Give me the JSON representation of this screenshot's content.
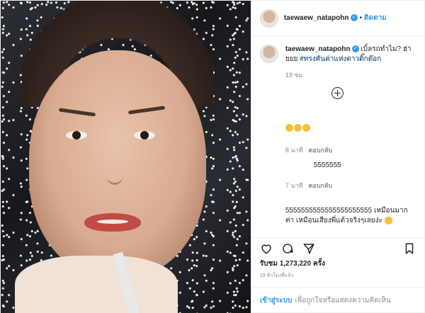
{
  "post": {
    "username": "taewaew_natapohn",
    "follow_label": "ติดตาม",
    "dot": "•",
    "verified_icon": "✓"
  },
  "caption": {
    "username": "taewaew_natapohn",
    "text": "เบิ้ลรถทำไม? ฮ่ายยย",
    "hashtag": "#ทรงคันค่าแห่งดาวติ๊กต๊อก",
    "time": "19 ชม."
  },
  "comments": [
    {
      "text": "",
      "time": "8 นาที",
      "reply_label": "ตอบกลับ",
      "emoji_count": 3
    },
    {
      "text": "5555555",
      "time": "7 นาที",
      "reply_label": "ตอบกลับ"
    },
    {
      "text": "5555555555555555555555 เหมือนมากค่า เหมือนเสียงพี่แต้วจริงๆเลยง่ะ",
      "emoji_count": 1
    }
  ],
  "stats": {
    "likes": "รับชม 1,273,220 ครั้ง",
    "posted": "19 ชั่วโมงที่แล้ว"
  },
  "footer": {
    "login_label": "เข้าสู่ระบบ",
    "rest_text": "เพื่อถูกใจหรือแสดงความคิดเห็น"
  }
}
